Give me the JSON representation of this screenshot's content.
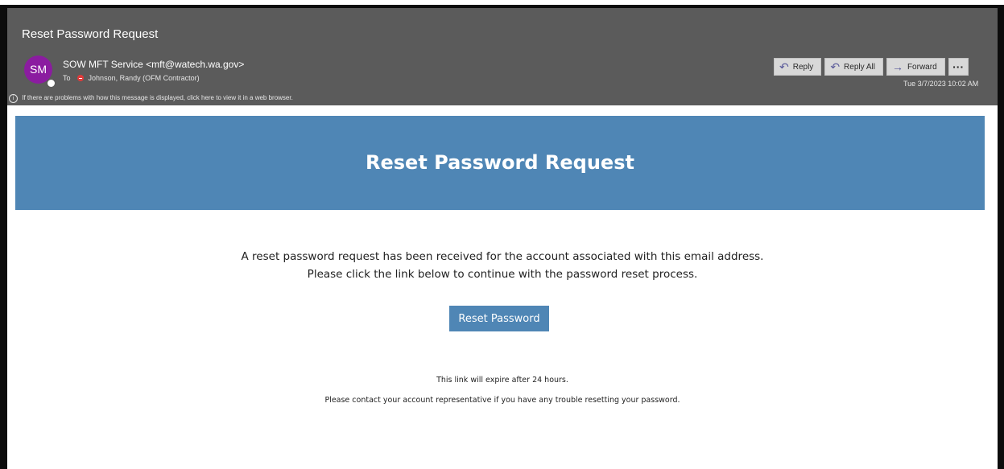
{
  "email": {
    "subject": "Reset Password Request",
    "avatar_initials": "SM",
    "sender": "SOW MFT Service <mft@watech.wa.gov>",
    "to_label": "To",
    "recipient": "Johnson, Randy (OFM Contractor)",
    "info_message": "If there are problems with how this message is displayed, click here to view it in a web browser.",
    "timestamp": "Tue 3/7/2023 10:02 AM",
    "actions": {
      "reply": "Reply",
      "reply_all": "Reply All",
      "forward": "Forward",
      "more": "···"
    }
  },
  "body": {
    "banner_title": "Reset Password Request",
    "message_line1": "A reset password request has been received for the account associated with this email address.",
    "message_line2": "Please click the link below to continue with the password reset process.",
    "button_label": "Reset Password",
    "note_line1": "This link will expire after 24 hours.",
    "note_line2": "Please contact your account representative if you have any trouble resetting your password."
  },
  "colors": {
    "header_bg": "#5b5b5b",
    "avatar": "#8b1ca0",
    "accent": "#4f86b5"
  }
}
